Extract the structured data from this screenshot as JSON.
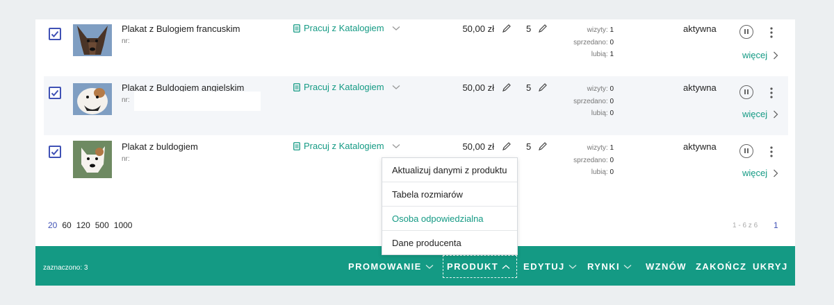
{
  "rows": [
    {
      "name": "Plakat z Bulogiem francuskim",
      "nr_label": "nr:",
      "catalog": "Pracuj z Katalogiem",
      "price": "50,00 zł",
      "quantity": "5",
      "stats": {
        "visits_label": "wizyty:",
        "visits": "1",
        "sold_label": "sprzedano:",
        "sold": "0",
        "likes_label": "lubią:",
        "likes": "1"
      },
      "status": "aktywna",
      "more": "więcej",
      "checked": true
    },
    {
      "name": "Plakat z Buldogiem angielskim",
      "nr_label": "nr:",
      "catalog": "Pracuj z Katalogiem",
      "price": "50,00 zł",
      "quantity": "5",
      "stats": {
        "visits_label": "wizyty:",
        "visits": "0",
        "sold_label": "sprzedano:",
        "sold": "0",
        "likes_label": "lubią:",
        "likes": "0"
      },
      "status": "aktywna",
      "more": "więcej",
      "checked": true
    },
    {
      "name": "Plakat z buldogiem",
      "nr_label": "nr:",
      "catalog": "Pracuj z Katalogiem",
      "price": "50,00 zł",
      "quantity": "5",
      "stats": {
        "visits_label": "wizyty:",
        "visits": "1",
        "sold_label": "sprzedano:",
        "sold": "0",
        "likes_label": "lubią:",
        "likes": "0"
      },
      "status": "aktywna",
      "more": "więcej",
      "checked": true
    }
  ],
  "page_sizes": [
    "20",
    "60",
    "120",
    "500",
    "1000"
  ],
  "page_size_selected": "20",
  "range": "1 - 6 z 6",
  "current_page": "1",
  "dropdown": {
    "items": [
      "Aktualizuj danymi z produktu",
      "Tabela rozmiarów",
      "Osoba odpowiedzialna",
      "Dane producenta"
    ],
    "highlighted": "Osoba odpowiedzialna"
  },
  "bottom_bar": {
    "selected": "zaznaczono: 3",
    "promote": "PROMOWANIE",
    "product": "PRODUKT",
    "edit": "EDYTUJ",
    "markets": "RYNKI",
    "resume": "WZNÓW",
    "finish": "ZAKOŃCZ",
    "hide": "UKRYJ"
  },
  "colors": {
    "accent": "#149a84",
    "link_blue": "#3f51b5",
    "background": "#eceff1"
  }
}
